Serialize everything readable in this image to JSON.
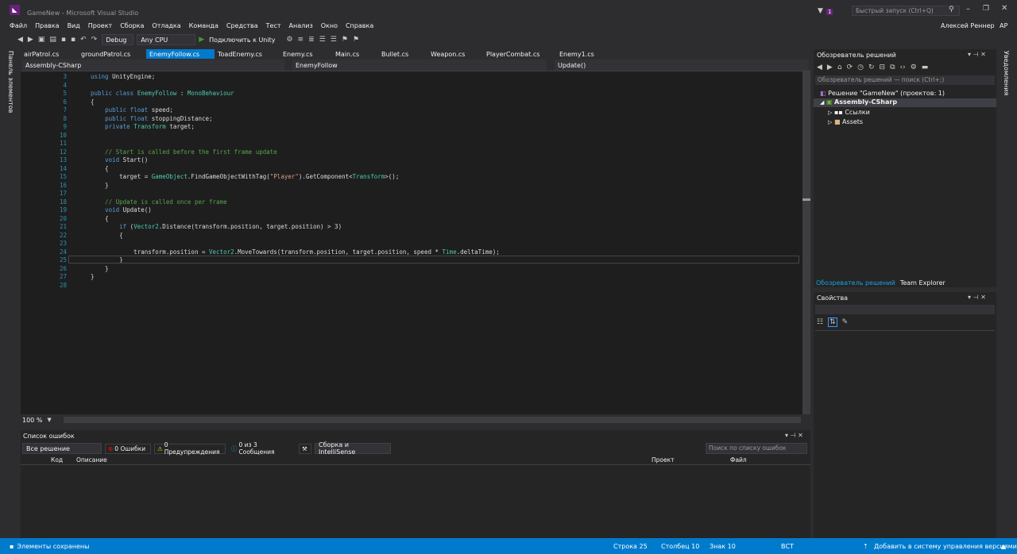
{
  "window": {
    "title": "GameNew - Microsoft Visual Studio",
    "quick_launch_placeholder": "Быстрый запуск (Ctrl+Q)",
    "notif_count": "1",
    "user_name": "Алексей Реннер",
    "user_initials": "АР"
  },
  "menu": [
    "Файл",
    "Правка",
    "Вид",
    "Проект",
    "Сборка",
    "Отладка",
    "Команда",
    "Средства",
    "Тест",
    "Анализ",
    "Окно",
    "Справка"
  ],
  "toolbar": {
    "config": "Debug",
    "platform": "Any CPU",
    "run_label": "Подключить к Unity"
  },
  "left_strip_label": "Панель элементов",
  "right_strip_label": "Уведомления",
  "tabs": [
    "airPatrol.cs",
    "groundPatrol.cs",
    "EnemyFollow.cs",
    "ToadEnemy.cs",
    "Enemy.cs",
    "Main.cs",
    "Bullet.cs",
    "Weapon.cs",
    "PlayerCombat.cs",
    "Enemy1.cs"
  ],
  "active_tab": "EnemyFollow.cs",
  "nav": {
    "project": "Assembly-CSharp",
    "class": "EnemyFollow",
    "member": "Update()"
  },
  "code_lines": [
    {
      "n": "3",
      "t": "using UnityEngine;"
    },
    {
      "n": "4",
      "t": ""
    },
    {
      "n": "5",
      "t": "public class EnemyFollow : MonoBehaviour"
    },
    {
      "n": "6",
      "t": "{"
    },
    {
      "n": "7",
      "t": "    public float speed;"
    },
    {
      "n": "8",
      "t": "    public float stoppingDistance;"
    },
    {
      "n": "9",
      "t": "    private Transform target;"
    },
    {
      "n": "10",
      "t": ""
    },
    {
      "n": "11",
      "t": ""
    },
    {
      "n": "12",
      "t": "    // Start is called before the first frame update"
    },
    {
      "n": "13",
      "t": "    void Start()"
    },
    {
      "n": "14",
      "t": "    {"
    },
    {
      "n": "15",
      "t": "        target = GameObject.FindGameObjectWithTag(\"Player\").GetComponent<Transform>();"
    },
    {
      "n": "16",
      "t": "    }"
    },
    {
      "n": "17",
      "t": ""
    },
    {
      "n": "18",
      "t": "    // Update is called once per frame"
    },
    {
      "n": "19",
      "t": "    void Update()"
    },
    {
      "n": "20",
      "t": "    {"
    },
    {
      "n": "21",
      "t": "        if (Vector2.Distance(transform.position, target.position) > 3)"
    },
    {
      "n": "22",
      "t": "        {"
    },
    {
      "n": "23",
      "t": ""
    },
    {
      "n": "24",
      "t": "            transform.position = Vector2.MoveTowards(transform.position, target.position, speed * Time.deltaTime);"
    },
    {
      "n": "25",
      "t": "        }"
    },
    {
      "n": "26",
      "t": "    }"
    },
    {
      "n": "27",
      "t": "}"
    },
    {
      "n": "28",
      "t": ""
    }
  ],
  "zoom": "100 %",
  "errors": {
    "title": "Список ошибок",
    "scope": "Все решение",
    "errors_btn": "0 Ошибки",
    "warnings_btn": "0 Предупреждения",
    "messages_btn": "0 из 3 Сообщения",
    "build_filter": "Сборка и IntelliSense",
    "search_placeholder": "Поиск по списку ошибок",
    "columns": [
      "Код",
      "Описание",
      "Проект",
      "Файл"
    ]
  },
  "solution": {
    "title": "Обозреватель решений",
    "search_placeholder": "Обозреватель решений — поиск (Ctrl+;)",
    "root": "Решение \"GameNew\"  (проектов: 1)",
    "project": "Assembly-CSharp",
    "refs": "Ссылки",
    "assets": "Assets",
    "tab1": "Обозреватель решений",
    "tab2": "Team Explorer"
  },
  "properties": {
    "title": "Свойства"
  },
  "status": {
    "left": "Элементы сохранены",
    "line": "Строка 25",
    "col": "Столбец 10",
    "ch": "Знак 10",
    "mode": "ВСТ",
    "vcs": "Добавить в систему управления версиями"
  }
}
